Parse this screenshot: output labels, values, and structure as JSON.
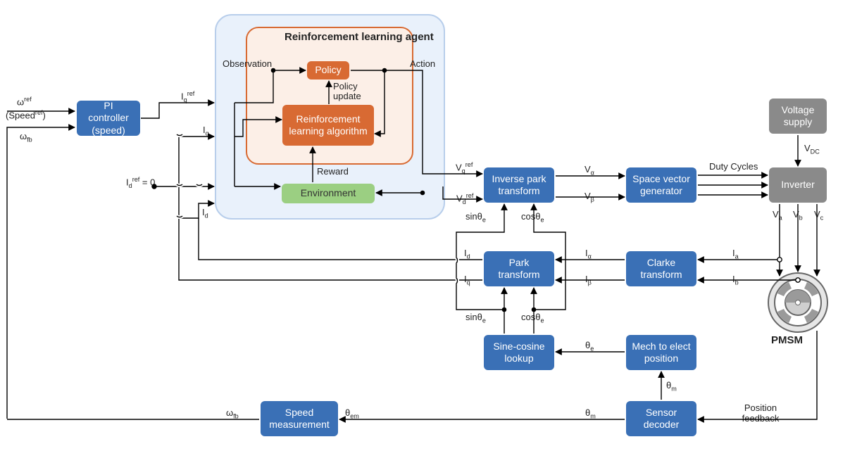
{
  "blocks": {
    "pi_controller": "PI controller (speed)",
    "rl_agent_title": "Reinforcement learning agent",
    "policy": "Policy",
    "rl_algorithm": "Reinforcement learning algorithm",
    "environment": "Environment",
    "inverse_park": "Inverse park transform",
    "space_vector": "Space vector generator",
    "voltage_supply": "Voltage supply",
    "inverter": "Inverter",
    "park_transform": "Park transform",
    "clarke_transform": "Clarke transform",
    "sine_cosine": "Sine-cosine lookup",
    "mech_to_elect": "Mech to elect position",
    "sensor_decoder": "Sensor decoder",
    "speed_measurement": "Speed measurement",
    "pmsm": "PMSM"
  },
  "labels": {
    "omega_ref": "ω<sup>ref</sup>",
    "speed_ref": "(Speed<sup>ref</sup>)",
    "omega_fb_left": "ω<sub>fb</sub>",
    "iq_ref": "I<sub>q</sub><sup>ref</sup>",
    "iq": "I<sub>q</sub>",
    "id_ref_0": "I<sub>d</sub><sup>ref</sup> = 0",
    "id": "I<sub>d</sub>",
    "observation": "Observation",
    "action": "Action",
    "policy_update": "Policy update",
    "reward": "Reward",
    "vq_ref": "V<sub>q</sub><sup>ref</sup>",
    "vd_ref": "V<sub>d</sub><sup>ref</sup>",
    "sin_theta_e": "sinθ<sub>e</sub>",
    "cos_theta_e": "cosθ<sub>e</sub>",
    "v_alpha": "V<sub>α</sub>",
    "v_beta": "V<sub>β</sub>",
    "duty_cycles": "Duty Cycles",
    "v_dc": "V<sub>DC</sub>",
    "va": "V<sub>a</sub>",
    "vb": "V<sub>b</sub>",
    "vc": "V<sub>c</sub>",
    "i_alpha": "I<sub>α</sub>",
    "i_beta": "I<sub>β</sub>",
    "ia": "I<sub>a</sub>",
    "ib": "I<sub>b</sub>",
    "id2": "I<sub>d</sub>",
    "iq2": "I<sub>q</sub>",
    "theta_e": "θ<sub>e</sub>",
    "theta_m": "θ<sub>m</sub>",
    "theta_m2": "θ<sub>m</sub>",
    "theta_em": "θ<sub>em</sub>",
    "omega_fb2": "ω<sub>fb</sub>",
    "position_feedback": "Position feedback"
  }
}
